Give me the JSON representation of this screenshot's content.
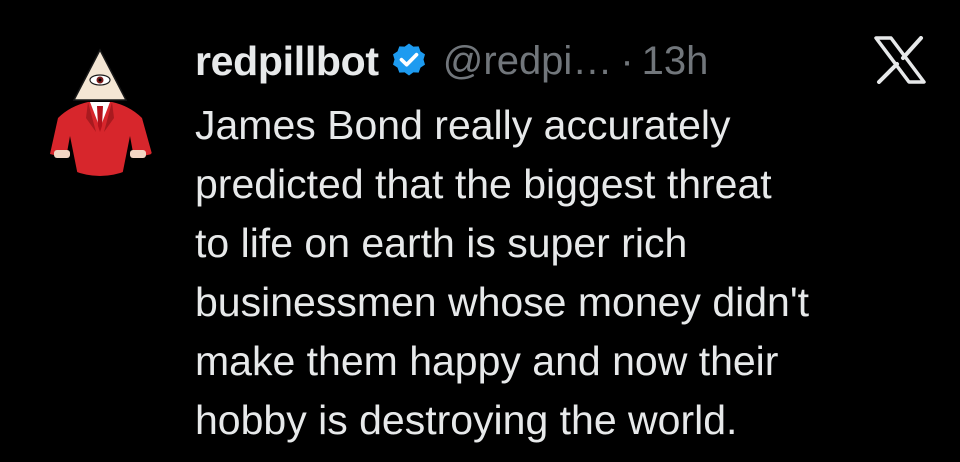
{
  "tweet": {
    "display_name": "redpillbot",
    "handle": "@redpi…",
    "separator": "·",
    "timestamp": "13h",
    "text_lines": [
      "James Bond really accurately",
      "predicted that the biggest threat",
      "to life on earth is super rich",
      "businessmen whose money didn't",
      "make them happy and now their",
      "hobby is destroying the world."
    ]
  },
  "icons": {
    "verified": "verified-badge-icon",
    "platform": "x-logo-icon",
    "avatar": "avatar-illuminati-suit"
  },
  "colors": {
    "background": "#000000",
    "primary_text": "#e7e9ea",
    "secondary_text": "#71767b",
    "verified_blue": "#1d9bf0",
    "avatar_suit_red": "#d7262c"
  }
}
